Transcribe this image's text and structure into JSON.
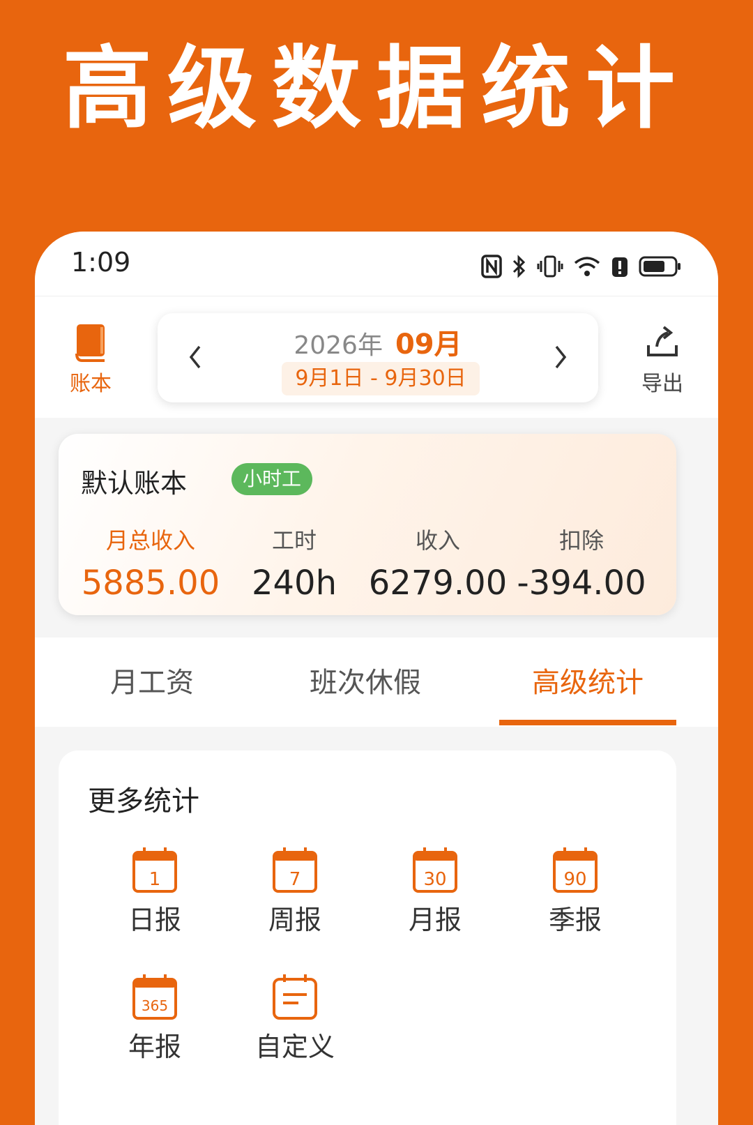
{
  "headline": "高级数据统计",
  "status_bar": {
    "time": "1:09"
  },
  "header": {
    "book_label": "账本",
    "export_label": "导出",
    "year": "2026年",
    "month": "09月",
    "range": "9月1日 - 9月30日"
  },
  "summary": {
    "ledger_name": "默认账本",
    "tag": "小时工",
    "stats": [
      {
        "label": "月总收入",
        "value": "5885.00"
      },
      {
        "label": "工时",
        "value": "240h"
      },
      {
        "label": "收入",
        "value": "6279.00"
      },
      {
        "label": "扣除",
        "value": "-394.00"
      }
    ]
  },
  "tabs": [
    {
      "label": "月工资"
    },
    {
      "label": "班次休假"
    },
    {
      "label": "高级统计"
    }
  ],
  "more_stats": {
    "title": "更多统计",
    "items": [
      {
        "label": "日报",
        "icon": "calendar-1-icon",
        "number": "1"
      },
      {
        "label": "周报",
        "icon": "calendar-7-icon",
        "number": "7"
      },
      {
        "label": "月报",
        "icon": "calendar-30-icon",
        "number": "30"
      },
      {
        "label": "季报",
        "icon": "calendar-90-icon",
        "number": "90"
      },
      {
        "label": "年报",
        "icon": "calendar-365-icon",
        "number": "365"
      },
      {
        "label": "自定义",
        "icon": "calendar-custom-icon"
      }
    ]
  },
  "colors": {
    "accent": "#E8650E",
    "tag_green": "#5CB85C"
  }
}
